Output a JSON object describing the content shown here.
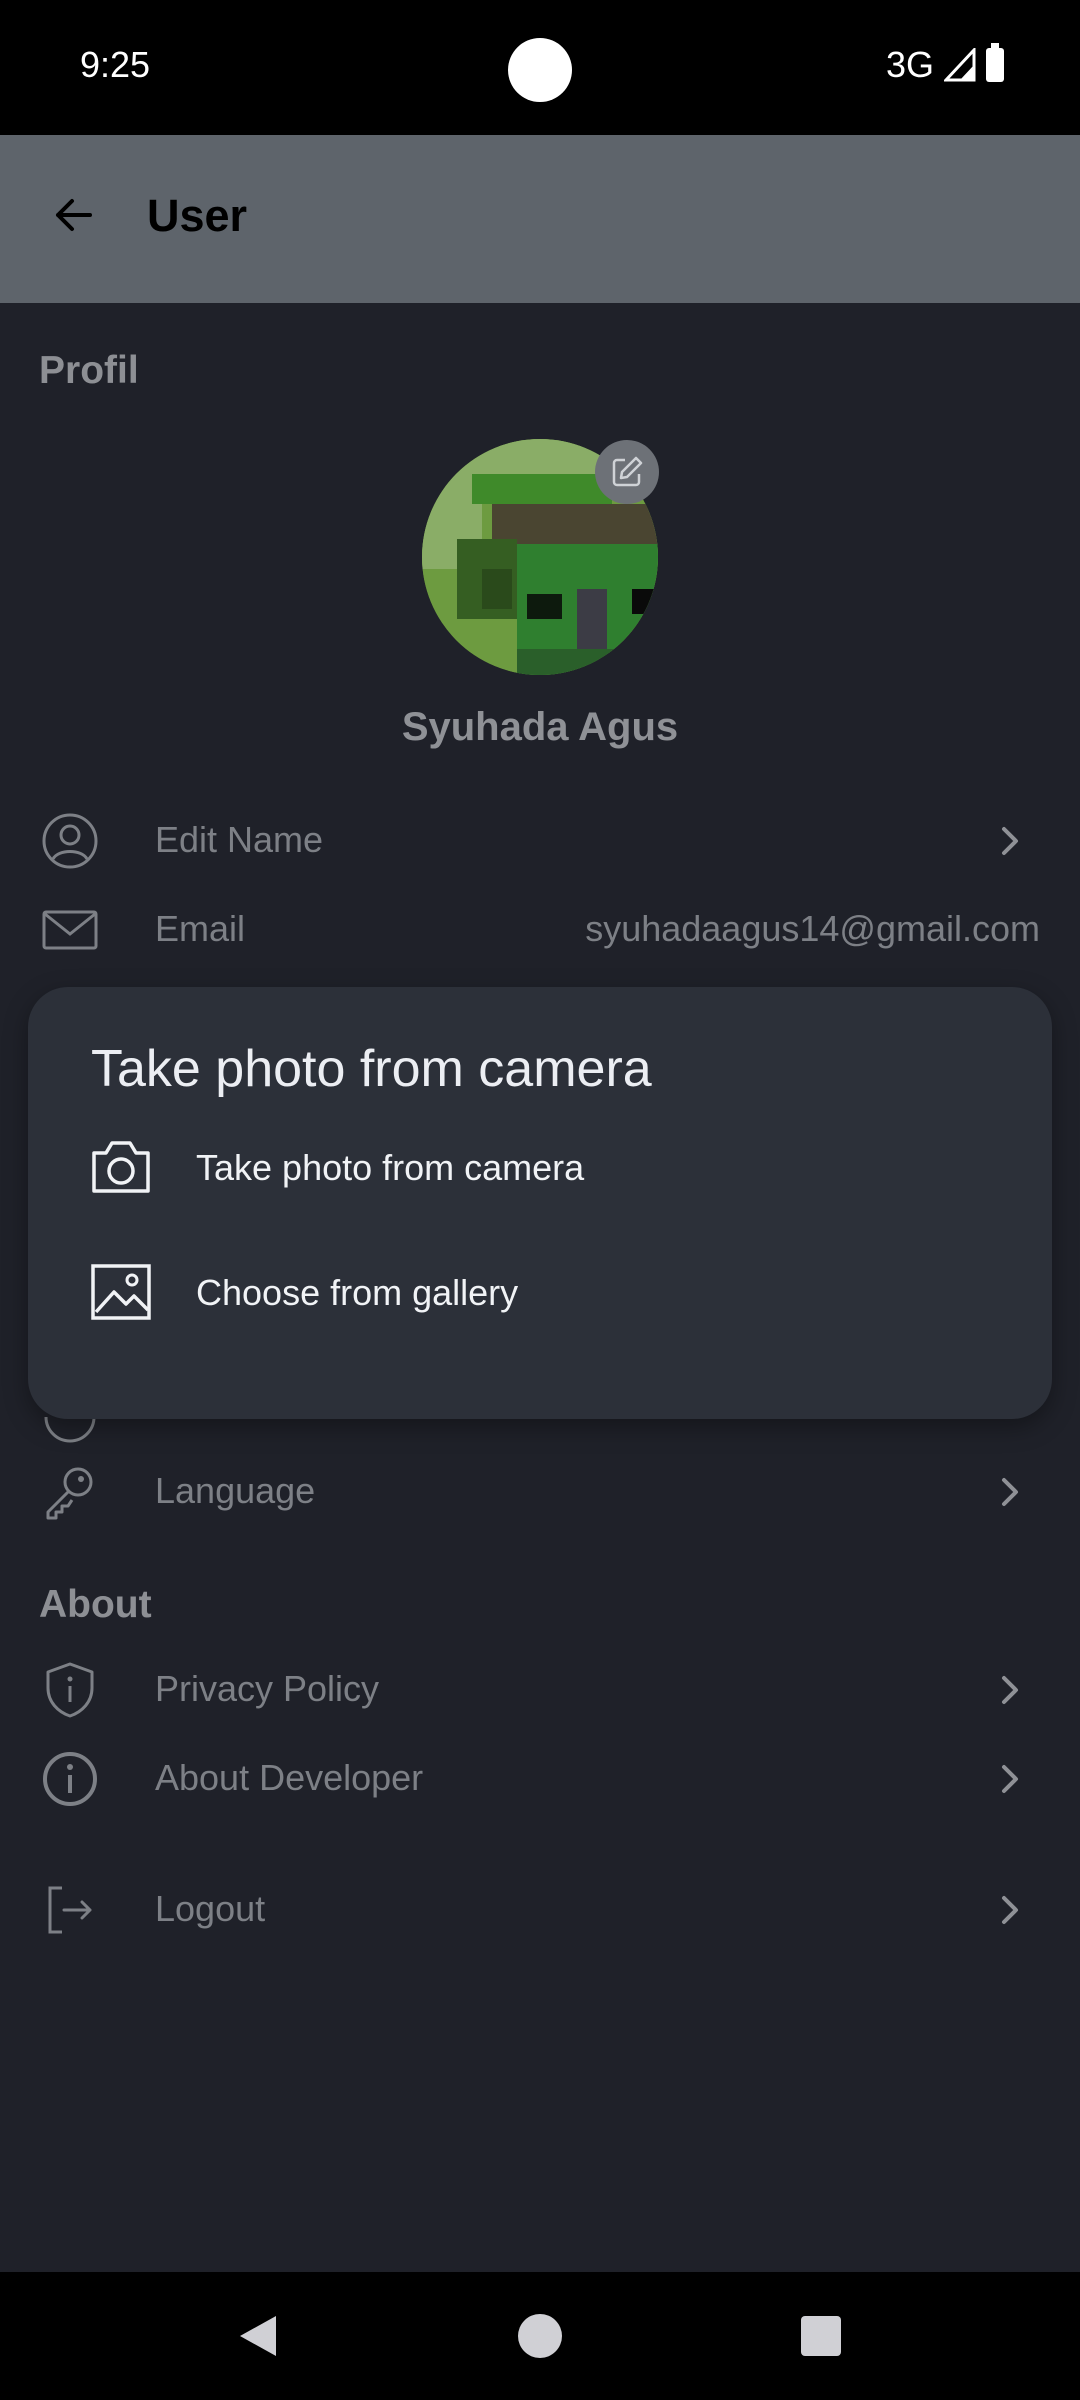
{
  "status_bar": {
    "time": "9:25",
    "network": "3G"
  },
  "toolbar": {
    "title": "User"
  },
  "sections": {
    "profile": "Profil",
    "about": "About"
  },
  "profile": {
    "name": "Syuhada Agus"
  },
  "items": {
    "edit_name": "Edit Name",
    "email_label": "Email",
    "email_value": "syuhadaagus14@gmail.com",
    "language": "Language",
    "privacy_policy": "Privacy Policy",
    "about_developer": "About Developer",
    "logout": "Logout"
  },
  "sheet": {
    "title": "Take photo from camera",
    "camera_option": "Take photo from camera",
    "gallery_option": "Choose from gallery"
  },
  "icons": [
    "arrow-back-icon",
    "pencil-edit-icon",
    "user-circle-icon",
    "mail-icon",
    "key-icon",
    "shield-info-icon",
    "info-circle-icon",
    "logout-icon",
    "chevron-right-icon",
    "camera-icon",
    "image-icon"
  ],
  "colors": {
    "background": "#1f2129",
    "toolbar": "#5e646b",
    "sheet": "#2c3039",
    "muted_text": "#7d8086"
  }
}
